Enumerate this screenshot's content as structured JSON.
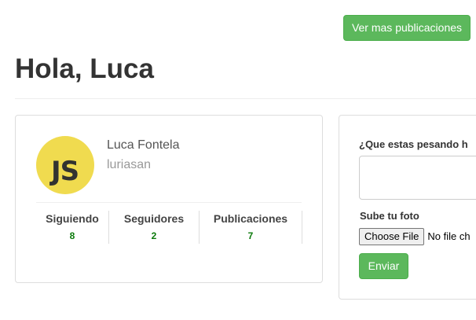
{
  "header": {
    "more_posts_button": "Ver mas publicaciones",
    "greeting": "Hola, Luca"
  },
  "profile": {
    "avatar_text": "JS",
    "full_name": "Luca Fontela",
    "username": "luriasan",
    "stats": [
      {
        "label": "Siguiendo",
        "value": "8"
      },
      {
        "label": "Seguidores",
        "value": "2"
      },
      {
        "label": "Publicaciones",
        "value": "7"
      }
    ]
  },
  "post_form": {
    "question_label": "¿Que estas pesando h",
    "textarea_value": "",
    "photo_label": "Sube tu foto",
    "file_button": "Choose File",
    "file_status": "No file ch",
    "submit_button": "Enviar"
  },
  "colors": {
    "accent_green": "#5cb85c",
    "stat_value_green": "#0b7a0b",
    "avatar_yellow": "#f0db4f"
  }
}
